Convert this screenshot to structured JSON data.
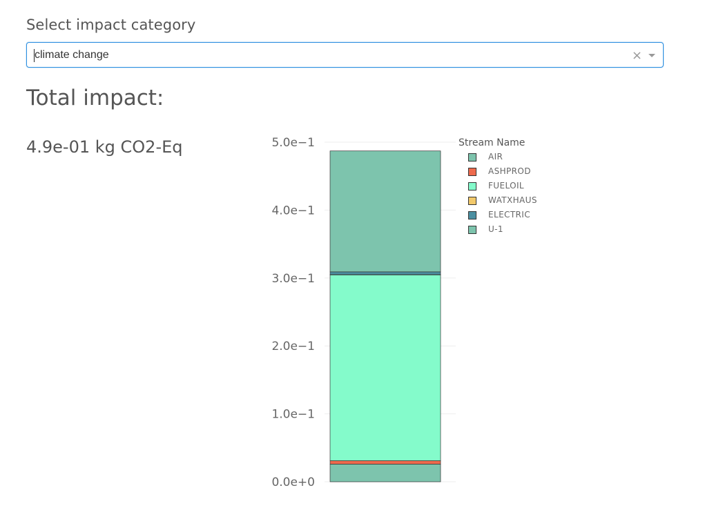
{
  "selector": {
    "label": "Select impact category",
    "value": "climate change",
    "clear_icon": "×"
  },
  "total": {
    "heading": "Total impact:",
    "value_text": "4.9e-01 kg CO2-Eq"
  },
  "chart_data": {
    "type": "bar",
    "stacked": true,
    "categories": [
      ""
    ],
    "legend_title": "Stream Name",
    "series": [
      {
        "name": "AIR",
        "color": "#7dc4ad",
        "values": [
          0.026
        ]
      },
      {
        "name": "ASHPROD",
        "color": "#ee6a4d",
        "values": [
          0.005
        ]
      },
      {
        "name": "FUELOIL",
        "color": "#84fbcb",
        "values": [
          0.274
        ]
      },
      {
        "name": "WATXHAUS",
        "color": "#f2c96b",
        "values": [
          0.0001
        ]
      },
      {
        "name": "ELECTRIC",
        "color": "#4b8fa1",
        "values": [
          0.004
        ]
      },
      {
        "name": "U-1",
        "color": "#7dc4ad",
        "values": [
          0.178
        ]
      }
    ],
    "ylim": [
      0,
      0.5
    ],
    "yticks": [
      "0.0e+0",
      "1.0e−1",
      "2.0e−1",
      "3.0e−1",
      "4.0e−1",
      "5.0e−1"
    ],
    "ytick_values": [
      0,
      0.1,
      0.2,
      0.3,
      0.4,
      0.5
    ],
    "grid": true,
    "legend_position": "right"
  }
}
